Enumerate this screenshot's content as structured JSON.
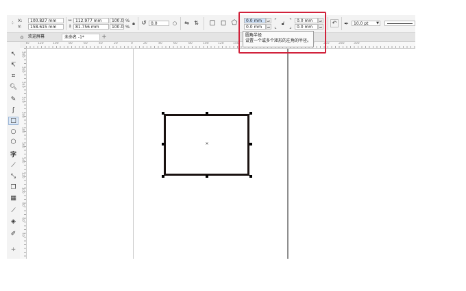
{
  "property_bar": {
    "x_label": "X:",
    "y_label": "Y:",
    "x_value": "100.827 mm",
    "y_value": "158.615 mm",
    "width_value": "112.977 mm",
    "height_value": "81.756 mm",
    "scale_x": "100.0",
    "scale_y": "100.0",
    "percent_symbol": "%",
    "rotation_value": "0.0",
    "corner_radius_top_left": "0.0 mm",
    "corner_radius_bottom_left": "0.0 mm",
    "corner_radius_top_right": "0.0 mm",
    "corner_radius_bottom_right": "0.0 mm",
    "outline_width": "10.0 pt"
  },
  "tabs": [
    {
      "label": "欢迎屏幕"
    },
    {
      "label": "未命名 -1*"
    }
  ],
  "tooltip": {
    "title": "圆角半径",
    "description": "设置一个或多个矩形的左角的半径。"
  },
  "ruler": {
    "horizontal_ticks": [
      "140",
      "120",
      "100",
      "80",
      "60",
      "40",
      "20",
      "0",
      "20",
      "40",
      "60",
      "80",
      "100",
      "120",
      "140",
      "160",
      "180",
      "200",
      "220",
      "240",
      "260",
      "280",
      "300"
    ],
    "vertical_ticks": [
      "280",
      "260",
      "240",
      "220",
      "200",
      "180",
      "160",
      "140",
      "120",
      "100",
      "80",
      "60",
      "40"
    ]
  },
  "colors": {
    "highlight": "#d1223b",
    "rectangle_stroke": "#1a1210",
    "field_selected": "#cfe3fb"
  }
}
